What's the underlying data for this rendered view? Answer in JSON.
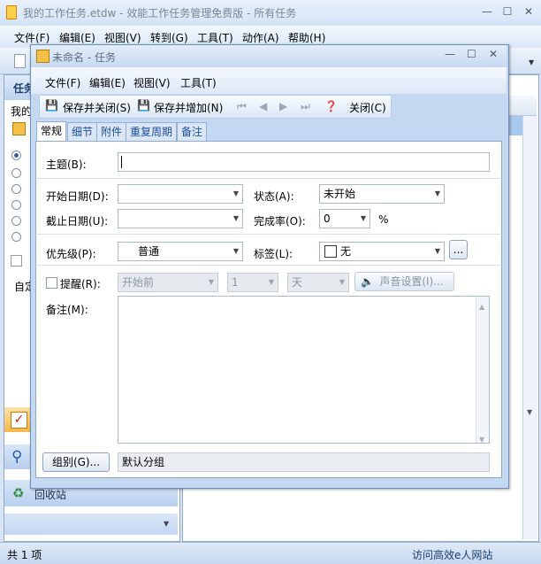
{
  "main": {
    "title": "我的工作任务.etdw - 效能工作任务管理免费版 - 所有任务",
    "menu": [
      "文件(F)",
      "编辑(E)",
      "视图(V)",
      "转到(G)",
      "工具(T)",
      "动作(A)",
      "帮助(H)"
    ],
    "left_pane_title": "任务",
    "left_pane_sub": "我的",
    "left_pane_auto": "自定",
    "recycle_label": "回收站",
    "status_count": "共 1 项",
    "status_link": "访问高效e人网站"
  },
  "dialog": {
    "title": "未命名 - 任务",
    "menu": [
      "文件(F)",
      "编辑(E)",
      "视图(V)",
      "工具(T)"
    ],
    "toolbar": {
      "save_close": "保存并关闭(S)",
      "save_add": "保存并增加(N)",
      "close": "关闭(C)"
    },
    "tabs": [
      "常规",
      "细节",
      "附件",
      "重复周期",
      "备注"
    ],
    "form": {
      "subject_label": "主题(B):",
      "subject_value": "",
      "start_label": "开始日期(D):",
      "start_value": "",
      "due_label": "截止日期(U):",
      "due_value": "",
      "status_label": "状态(A):",
      "status_value": "未开始",
      "complete_label": "完成率(O):",
      "complete_value": "0",
      "percent": "%",
      "priority_label": "优先级(P):",
      "priority_value": "普通",
      "tag_label": "标签(L):",
      "tag_value": "无",
      "tag_more": "...",
      "reminder_label": "提醒(R):",
      "reminder_when": "开始前",
      "reminder_num": "1",
      "reminder_unit": "天",
      "sound_btn": "声音设置(I)...",
      "notes_label": "备注(M):",
      "notes_value": "",
      "group_btn": "组别(G)...",
      "group_value": "默认分组"
    }
  }
}
